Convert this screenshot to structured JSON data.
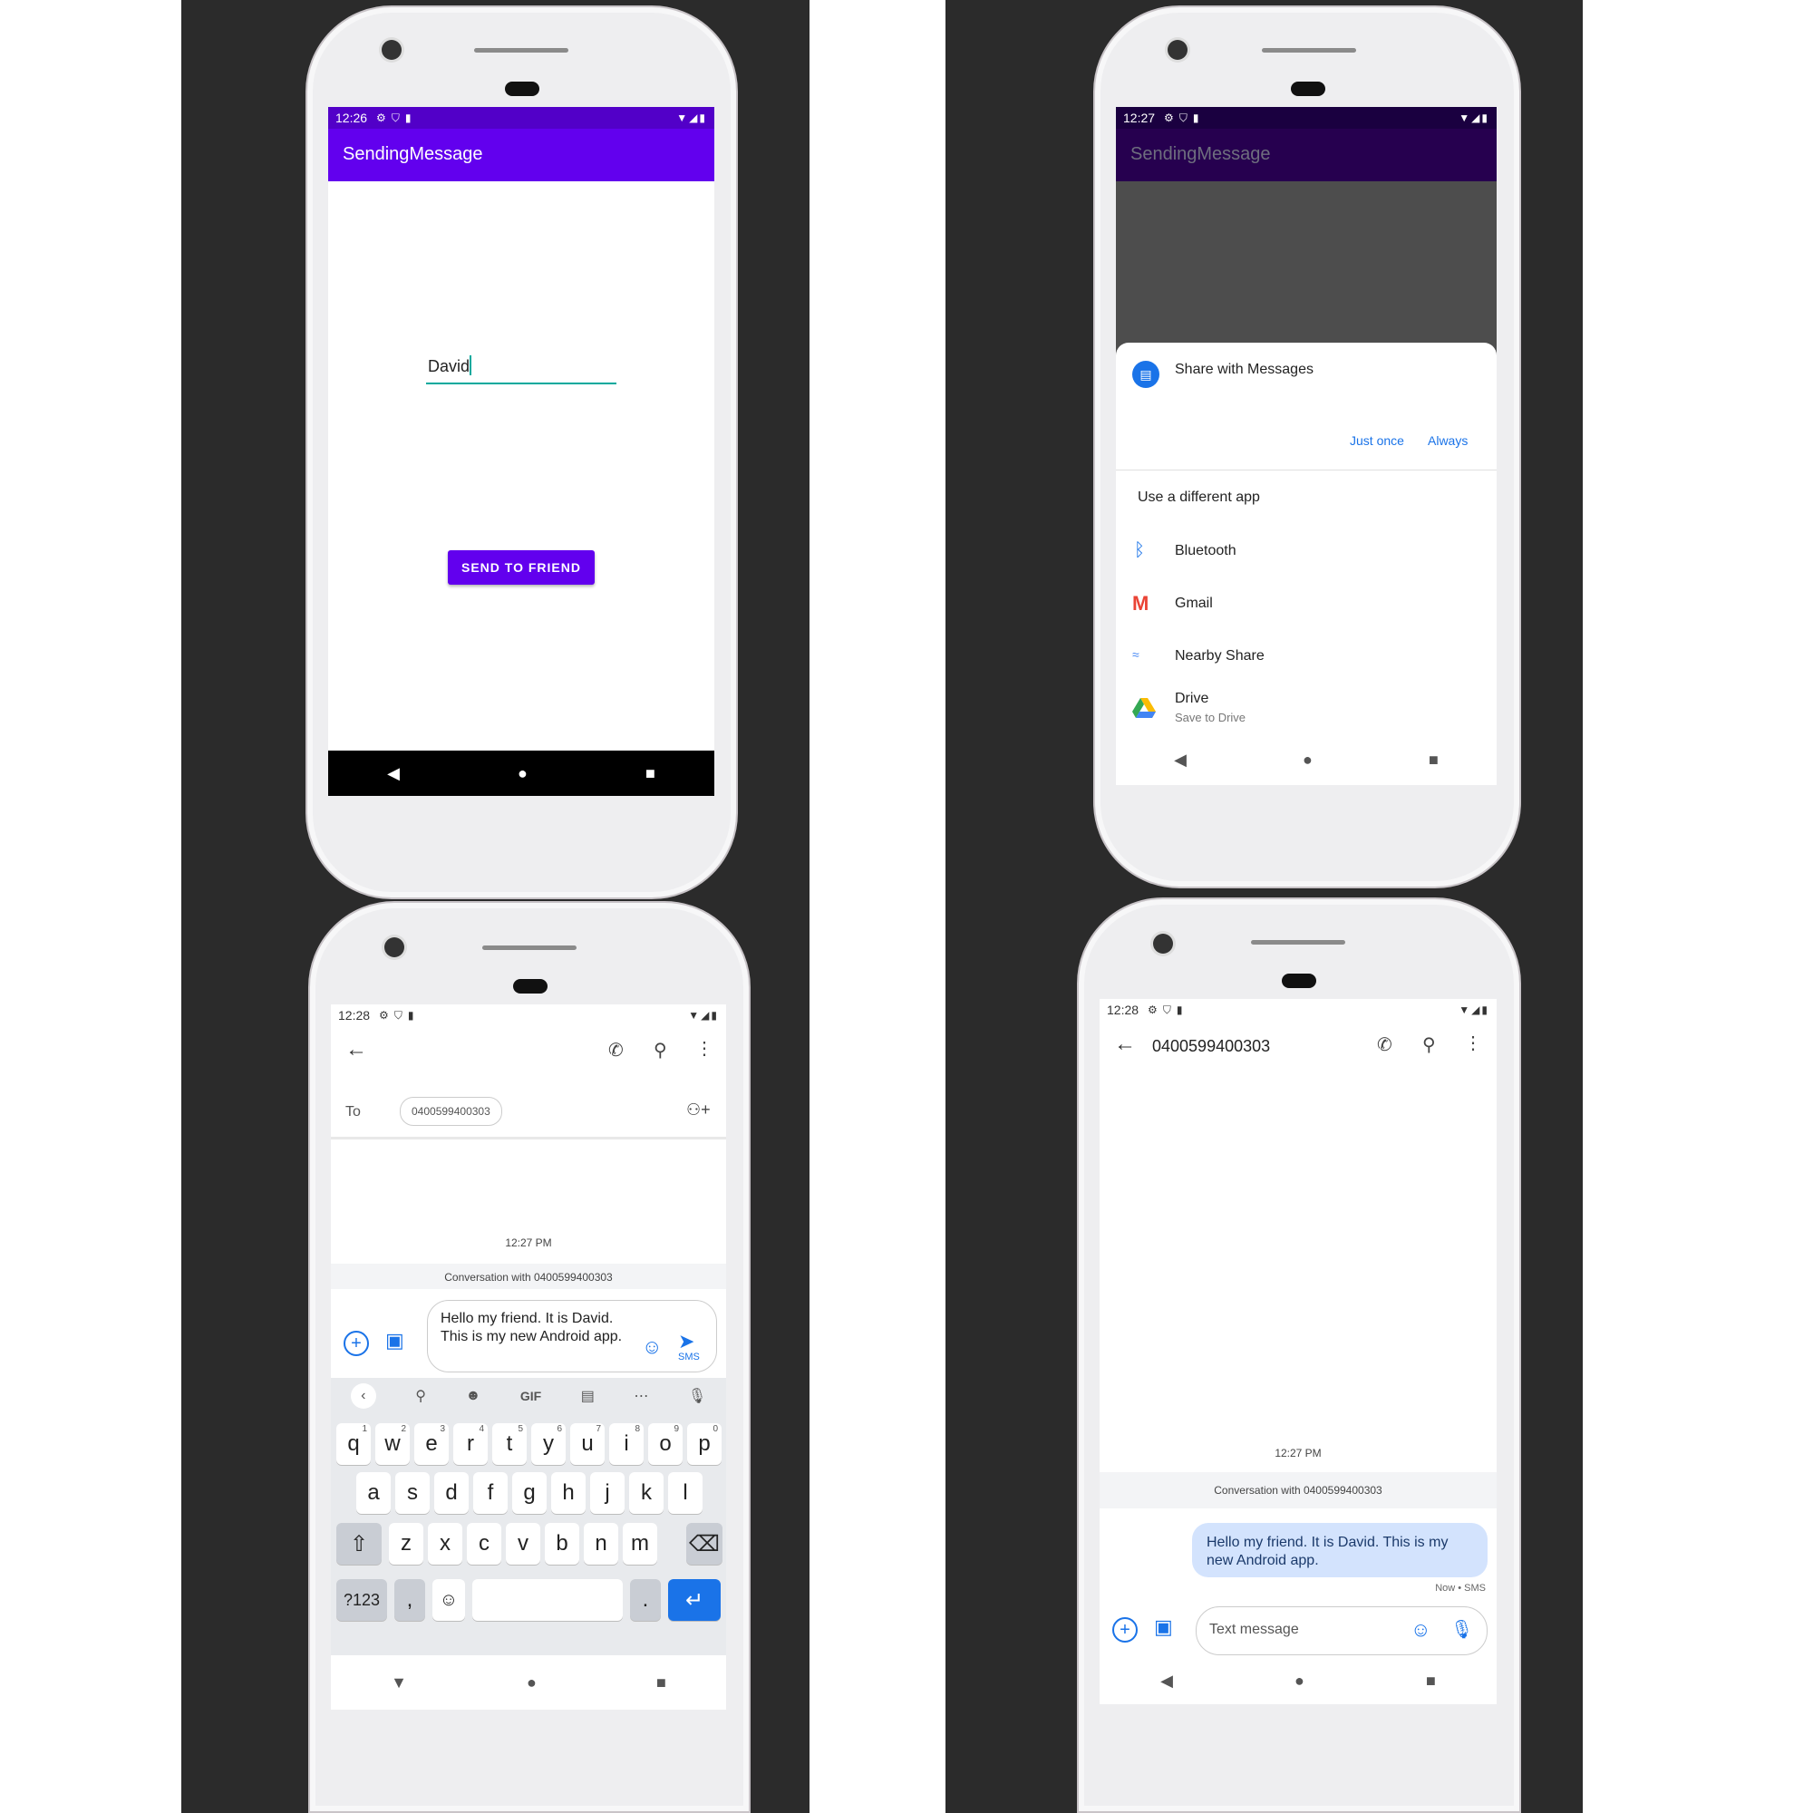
{
  "screen1": {
    "status_time": "12:26",
    "app_title": "SendingMessage",
    "name_input_value": "David",
    "send_button_label": "SEND TO FRIEND"
  },
  "screen2": {
    "status_time": "12:27",
    "app_title": "SendingMessage",
    "share_title": "Share with Messages",
    "just_once": "Just once",
    "always": "Always",
    "different_app": "Use a different app",
    "apps": [
      {
        "label": "Bluetooth",
        "icon": "bluetooth-icon",
        "color": "#1a73e8"
      },
      {
        "label": "Gmail",
        "icon": "gmail-icon",
        "color": "#ea4335"
      },
      {
        "label": "Nearby Share",
        "icon": "nearby-share-icon",
        "color": "#4285f4"
      },
      {
        "label": "Drive",
        "sublabel": "Save to Drive",
        "icon": "drive-icon",
        "color": "#34a853"
      }
    ]
  },
  "screen3": {
    "status_time": "12:28",
    "to_label": "To",
    "recipient_chip": "0400599400303",
    "timestamp": "12:27 PM",
    "conversation_label": "Conversation with 0400599400303",
    "compose_text": "Hello my friend. It is David. This is my new Android app.",
    "send_sub": "SMS",
    "suggestion_gif": "GIF",
    "keyboard": {
      "row1": [
        {
          "k": "q",
          "n": "1"
        },
        {
          "k": "w",
          "n": "2"
        },
        {
          "k": "e",
          "n": "3"
        },
        {
          "k": "r",
          "n": "4"
        },
        {
          "k": "t",
          "n": "5"
        },
        {
          "k": "y",
          "n": "6"
        },
        {
          "k": "u",
          "n": "7"
        },
        {
          "k": "i",
          "n": "8"
        },
        {
          "k": "o",
          "n": "9"
        },
        {
          "k": "p",
          "n": "0"
        }
      ],
      "row2": [
        "a",
        "s",
        "d",
        "f",
        "g",
        "h",
        "j",
        "k",
        "l"
      ],
      "row3": [
        "z",
        "x",
        "c",
        "v",
        "b",
        "n",
        "m"
      ],
      "symbols_key": "?123",
      "comma_key": ",",
      "period_key": "."
    }
  },
  "screen4": {
    "status_time": "12:28",
    "conversation_title": "0400599400303",
    "timestamp": "12:27 PM",
    "conversation_label": "Conversation with 0400599400303",
    "message_text": "Hello my friend. It is David. This is my new Android app.",
    "message_meta": "Now • SMS",
    "input_placeholder": "Text message"
  },
  "colors": {
    "app_purple": "#6200ee",
    "link_blue": "#1a73e8",
    "bubble": "#d3e3fd",
    "panel_bg": "#2b2b2b"
  }
}
